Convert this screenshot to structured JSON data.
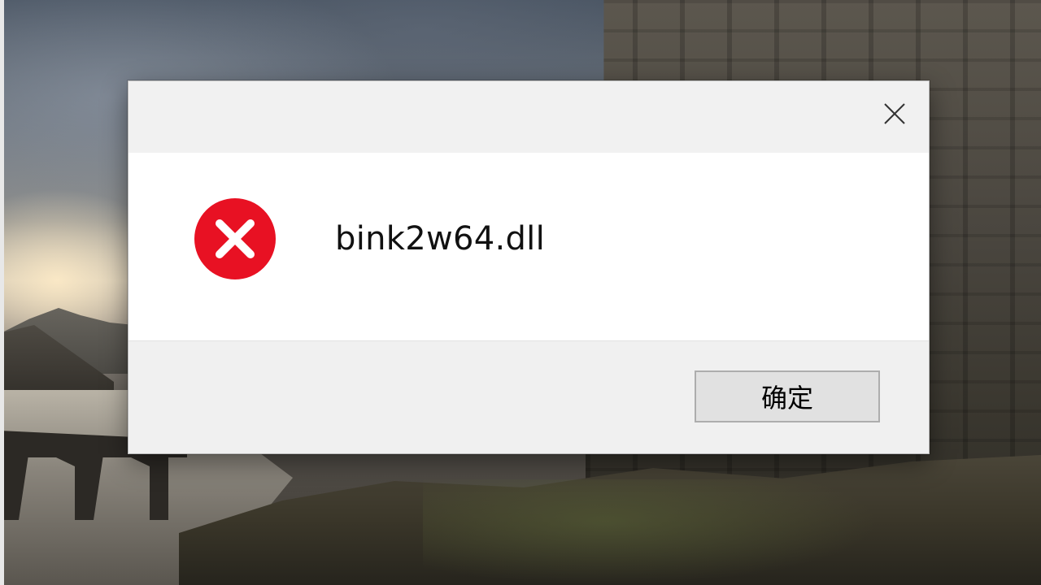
{
  "dialog": {
    "message": "bink2w64.dll",
    "ok_label": "确定",
    "icon": "error-icon",
    "close_icon": "close-icon"
  },
  "colors": {
    "error_red": "#e81123",
    "dialog_body": "#ffffff",
    "dialog_chrome": "#f0f0f0",
    "button_face": "#e1e1e1",
    "button_border": "#adadad"
  }
}
